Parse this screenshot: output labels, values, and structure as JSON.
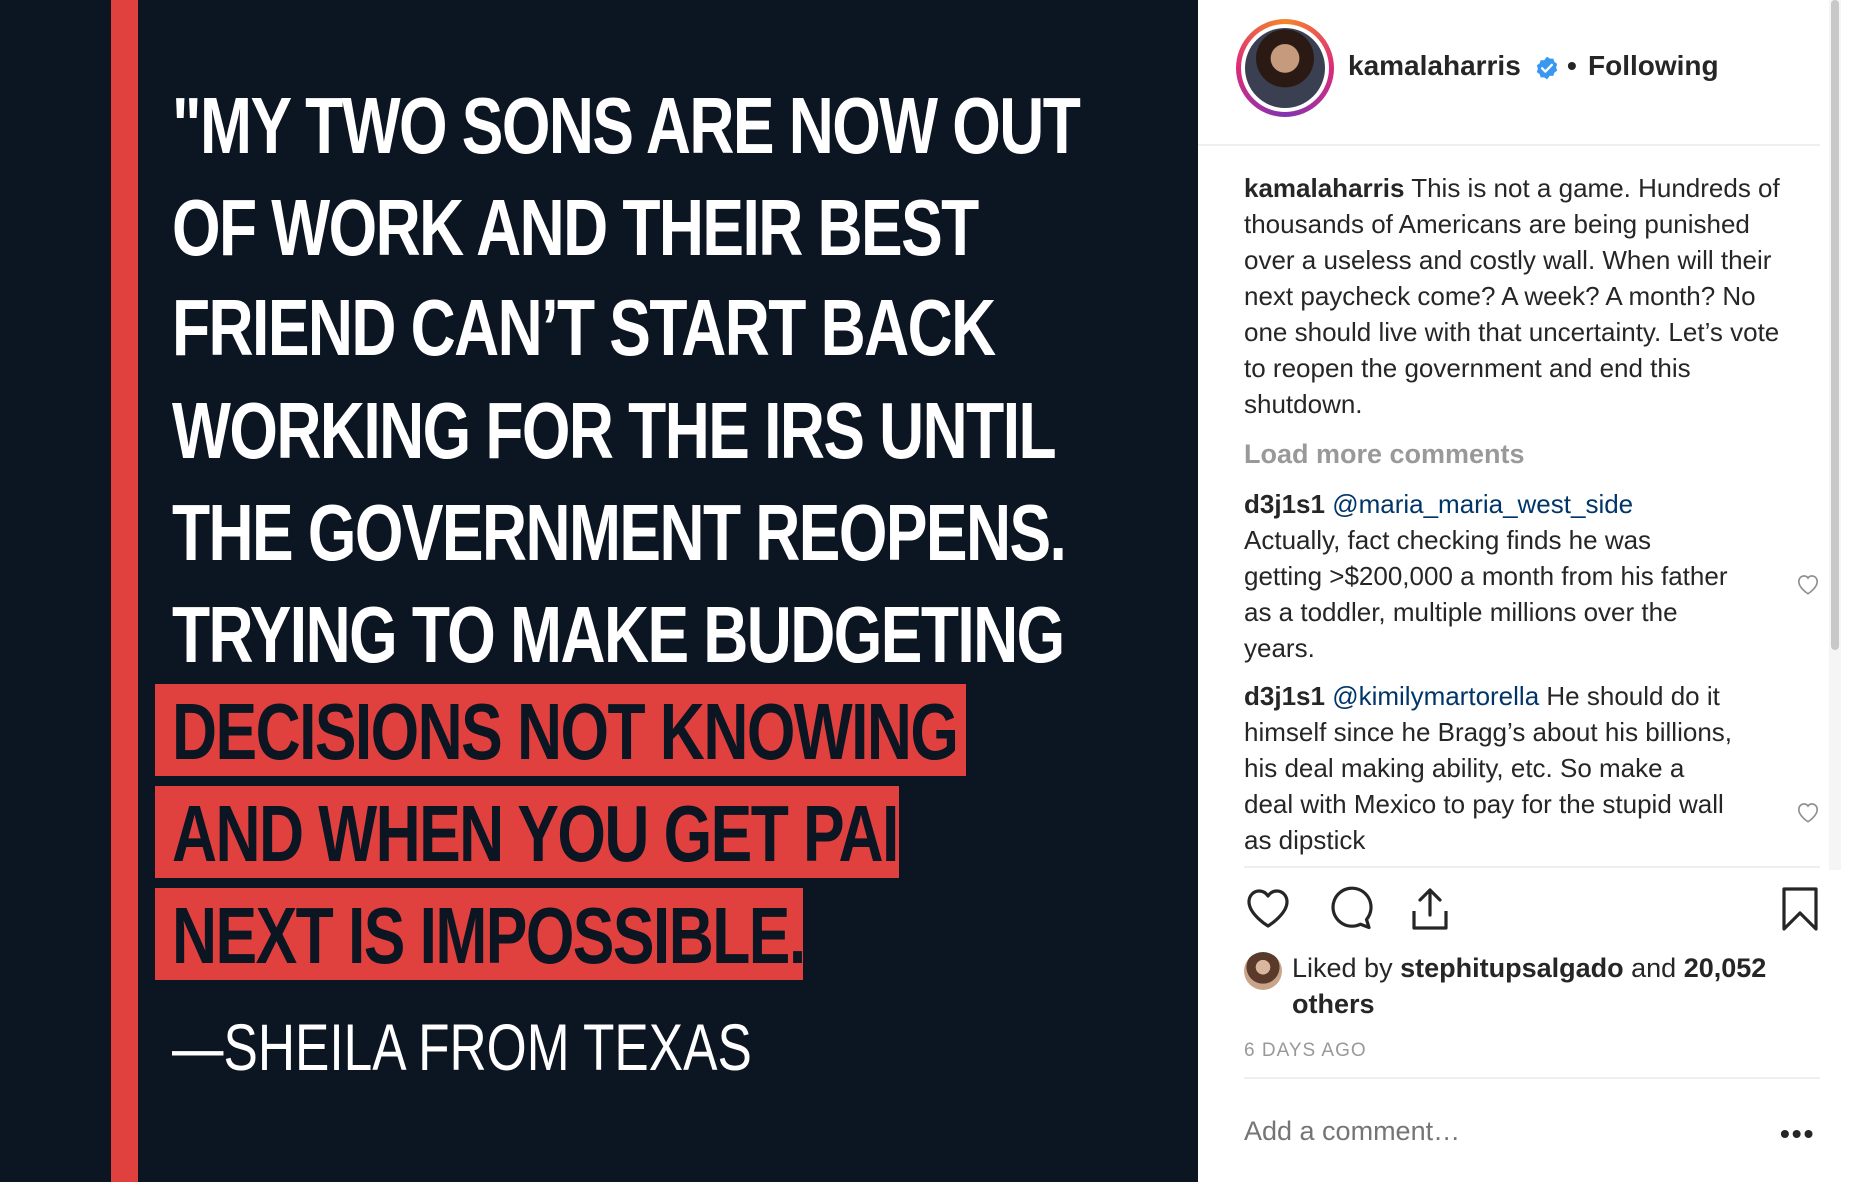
{
  "post": {
    "quote_lines": [
      "\"MY TWO SONS ARE NOW OUT",
      "OF WORK AND THEIR BEST",
      "FRIEND CAN’T START BACK",
      "WORKING FOR THE IRS UNTIL",
      "THE GOVERNMENT REOPENS.",
      "TRYING TO MAKE BUDGETING"
    ],
    "highlight_lines": [
      "DECISIONS NOT KNOWING IF",
      "AND WHEN YOU GET PAID",
      "NEXT IS IMPOSSIBLE.\""
    ],
    "attribution": "—SHEILA FROM TEXAS"
  },
  "header": {
    "username": "kamalaharris",
    "separator": "•",
    "follow_status": "Following"
  },
  "caption": {
    "user": "kamalaharris",
    "text": "This is not a game. Hundreds of thousands of Americans are being punished over a useless and costly wall. When will their next paycheck come? A week? A month? No one should live with that uncertainty. Let’s vote to reopen the government and end this shutdown."
  },
  "load_more": "Load more comments",
  "comments": [
    {
      "user": "d3j1s1",
      "mention": "@maria_maria_west_side",
      "text": "Actually, fact checking finds he was getting >$200,000 a month from his father as a toddler, multiple millions over the years."
    },
    {
      "user": "d3j1s1",
      "mention": "@kimilymartorella",
      "text": "He should do it himself since he Bragg’s about his billions, his deal making ability, etc. So make a deal with Mexico to pay for the stupid wall as dipstick"
    }
  ],
  "likes": {
    "prefix": "Liked by",
    "liker": "stephitupsalgado",
    "joiner": "and",
    "others": "20,052 others"
  },
  "timestamp": "6 DAYS AGO",
  "comment_input": {
    "placeholder": "Add a comment…"
  },
  "more_label": "•••",
  "colors": {
    "image_bg": "#0c1522",
    "accent_red": "#e0413f",
    "verified_blue": "#3897f0",
    "mention_blue": "#003569"
  },
  "icons": [
    "verified-badge-icon",
    "heart-icon",
    "comment-icon",
    "share-icon",
    "bookmark-icon",
    "more-options-icon"
  ]
}
